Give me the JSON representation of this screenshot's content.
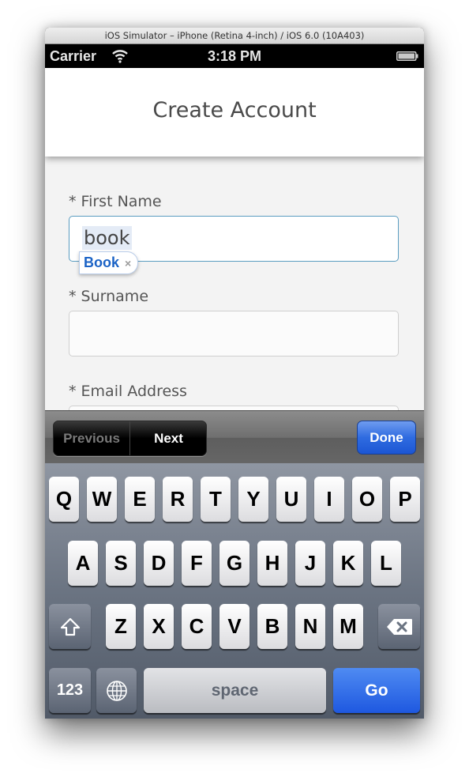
{
  "simulator": {
    "window_title": "iOS Simulator – iPhone (Retina 4-inch) / iOS 6.0 (10A403)"
  },
  "status_bar": {
    "carrier": "Carrier",
    "time": "3:18 PM",
    "wifi_icon": "wifi-icon",
    "battery_icon": "battery-full-icon"
  },
  "nav": {
    "title": "Create Account"
  },
  "form": {
    "fields": [
      {
        "label": "* First Name",
        "value": "book",
        "placeholder": ""
      },
      {
        "label": "* Surname",
        "value": "",
        "placeholder": ""
      },
      {
        "label": "* Email Address",
        "value": "",
        "placeholder": ""
      }
    ],
    "autocorrect": {
      "suggestion": "Book",
      "dismiss": "×"
    }
  },
  "accessory_bar": {
    "previous_label": "Previous",
    "next_label": "Next",
    "done_label": "Done"
  },
  "keyboard": {
    "row1": [
      "Q",
      "W",
      "E",
      "R",
      "T",
      "Y",
      "U",
      "I",
      "O",
      "P"
    ],
    "row2": [
      "A",
      "S",
      "D",
      "F",
      "G",
      "H",
      "J",
      "K",
      "L"
    ],
    "row3": [
      "Z",
      "X",
      "C",
      "V",
      "B",
      "N",
      "M"
    ],
    "shift_icon": "shift-icon",
    "backspace_icon": "backspace-icon",
    "numbers_label": "123",
    "globe_icon": "globe-icon",
    "space_label": "space",
    "go_label": "Go"
  },
  "colors": {
    "accent_blue": "#2f6be0",
    "autocorrect_text": "#1b63c6",
    "active_field_border": "#5a9cc0"
  }
}
